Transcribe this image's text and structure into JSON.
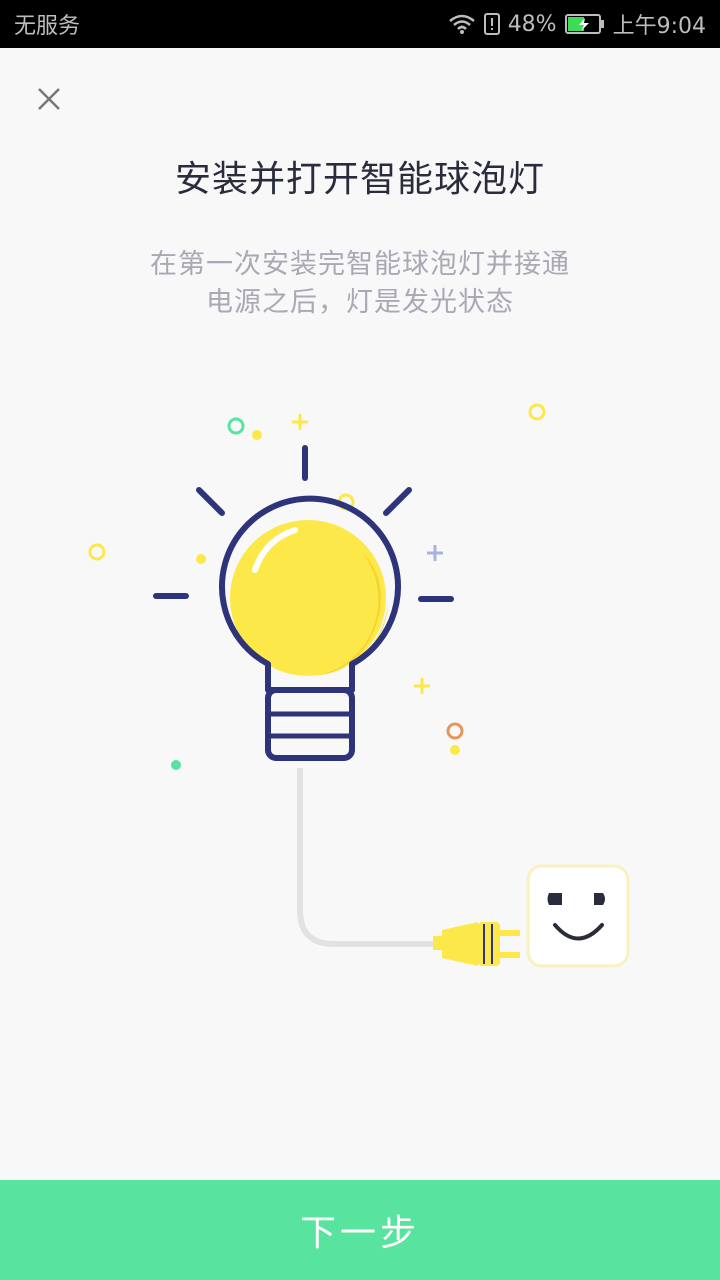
{
  "status_bar": {
    "carrier": "无服务",
    "battery_percent": "48%",
    "time": "上午9:04"
  },
  "header": {
    "close_icon": "close-icon"
  },
  "main": {
    "title": "安装并打开智能球泡灯",
    "subtitle_line1": "在第一次安装完智能球泡灯并接通",
    "subtitle_line2": "电源之后，灯是发光状态"
  },
  "illustration": {
    "bulb_color": "#fde84a",
    "outline_color": "#2e3479",
    "accent_green": "#58e39e",
    "icons": [
      "light-bulb-icon",
      "plug-icon",
      "smiley-socket-icon"
    ]
  },
  "footer": {
    "next_label": "下一步",
    "button_color": "#58e39e"
  }
}
